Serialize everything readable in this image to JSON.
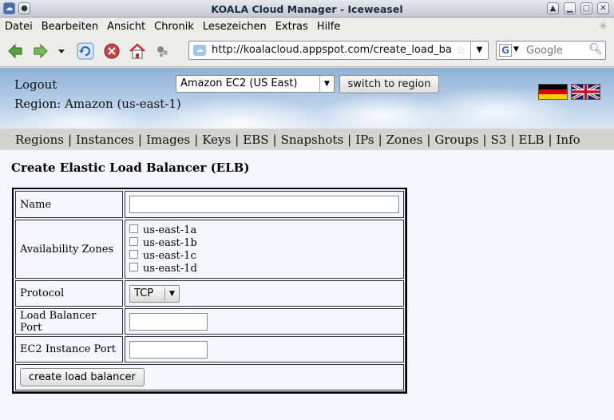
{
  "window": {
    "title": "KOALA Cloud Manager - Iceweasel"
  },
  "menu": [
    "Datei",
    "Bearbeiten",
    "Ansicht",
    "Chronik",
    "Lesezeichen",
    "Extras",
    "Hilfe"
  ],
  "urlbar": {
    "url": "http://koalacloud.appspot.com/create_load_ba"
  },
  "searchbar": {
    "engine": "G",
    "placeholder": "Google"
  },
  "header": {
    "logout": "Logout",
    "region": "Region: Amazon (us-east-1)",
    "region_select_value": "Amazon EC2 (US East)",
    "switch_button": "switch to region"
  },
  "tabs": [
    "Regions",
    "Instances",
    "Images",
    "Keys",
    "EBS",
    "Snapshots",
    "IPs",
    "Zones",
    "Groups",
    "S3",
    "ELB",
    "Info"
  ],
  "page": {
    "title": "Create Elastic Load Balancer (ELB)"
  },
  "form": {
    "name_label": "Name",
    "name_value": "",
    "zones_label": "Availability Zones",
    "zones": [
      "us-east-1a",
      "us-east-1b",
      "us-east-1c",
      "us-east-1d"
    ],
    "protocol_label": "Protocol",
    "protocol_value": "TCP",
    "lb_port_label": "Load Balancer Port",
    "lb_port_value": "",
    "instance_port_label": "EC2 Instance Port",
    "instance_port_value": "",
    "submit_label": "create load balancer"
  },
  "colors": {
    "accent_blue": "#9fc6ea",
    "tabbar": "#d3d3d1",
    "content_bg": "#f4f6fb"
  }
}
